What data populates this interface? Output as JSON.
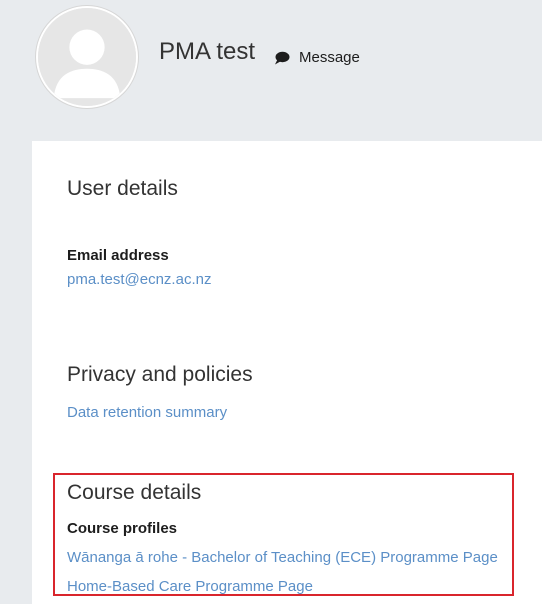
{
  "profile": {
    "name": "PMA test",
    "message_label": "Message"
  },
  "user_details": {
    "title": "User details",
    "email_label": "Email address",
    "email_value": "pma.test@ecnz.ac.nz"
  },
  "privacy": {
    "title": "Privacy and policies",
    "link": "Data retention summary"
  },
  "course_details": {
    "title": "Course details",
    "profiles_label": "Course profiles",
    "profiles": [
      "Wānanga ā rohe - Bachelor of Teaching (ECE) Programme Page",
      "Home-Based Care Programme Page"
    ]
  },
  "colors": {
    "link": "#5b8fc7",
    "highlight": "#d9252c",
    "background": "#e8ebee"
  },
  "icons": [
    "user-avatar-icon",
    "speech-bubble-icon"
  ]
}
